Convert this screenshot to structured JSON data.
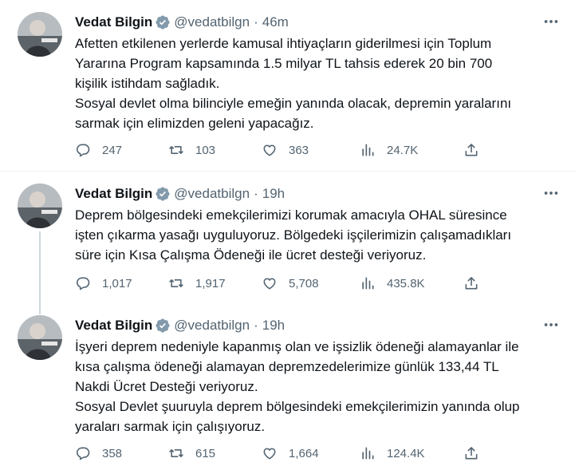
{
  "tweets": [
    {
      "author": "Vedat Bilgin",
      "handle": "@vedatbilgn",
      "separator": "·",
      "time": "46m",
      "lines": [
        "Afetten etkilenen yerlerde kamusal ihtiyaçların giderilmesi için Toplum",
        "Yararına Program kapsamında 1.5 milyar TL tahsis ederek 20 bin 700",
        "kişilik istihdam sağladık.",
        "Sosyal devlet olma bilinciyle emeğin yanında olacak, depremin yaralarını",
        "sarmak için elimizden geleni yapacağız."
      ],
      "replies": "247",
      "retweets": "103",
      "likes": "363",
      "views": "24.7K"
    },
    {
      "author": "Vedat Bilgin",
      "handle": "@vedatbilgn",
      "separator": "·",
      "time": "19h",
      "lines": [
        "Deprem bölgesindeki emekçilerimizi korumak amacıyla OHAL süresince",
        "işten çıkarma yasağı uyguluyoruz. Bölgedeki işçilerimizin çalışamadıkları",
        "süre için Kısa Çalışma Ödeneği ile ücret desteği veriyoruz."
      ],
      "replies": "1,017",
      "retweets": "1,917",
      "likes": "5,708",
      "views": "435.8K"
    },
    {
      "author": "Vedat Bilgin",
      "handle": "@vedatbilgn",
      "separator": "·",
      "time": "19h",
      "lines": [
        "İşyeri deprem nedeniyle kapanmış olan ve işsizlik ödeneği alamayanlar ile",
        "kısa çalışma ödeneği alamayan depremzedelerimize günlük 133,44 TL",
        "Nakdi Ücret Desteği veriyoruz.",
        "Sosyal Devlet şuuruyla deprem bölgesindeki emekçilerimizin yanında olup",
        "yaraları sarmak için çalışıyoruz."
      ],
      "replies": "358",
      "retweets": "615",
      "likes": "1,664",
      "views": "124.4K"
    }
  ],
  "icons": {
    "reply": "reply-icon",
    "retweet": "retweet-icon",
    "like": "like-icon",
    "views": "views-icon",
    "share": "share-icon",
    "more": "more-icon",
    "verified": "verified-badge-icon"
  },
  "colors": {
    "verified_badge": "#829aab",
    "secondary_text": "#536471",
    "thread_line": "#cfd9de",
    "divider": "#eff3f4"
  }
}
